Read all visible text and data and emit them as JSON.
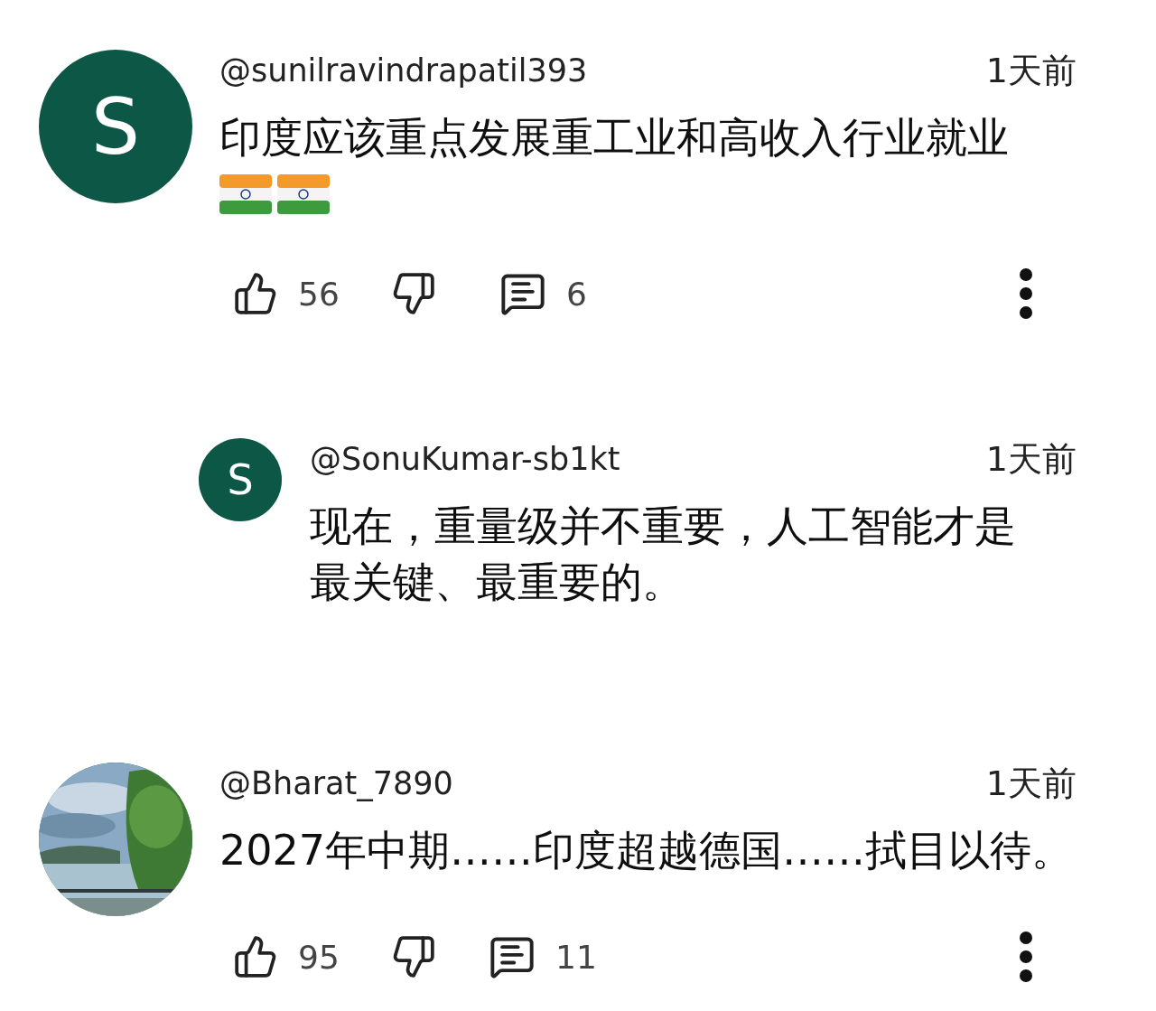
{
  "comments": [
    {
      "kind": "top",
      "avatar": {
        "kind": "letter",
        "letter": "S"
      },
      "username": "@sunilravindrapatil393",
      "time": "1天前",
      "text": "印度应该重点发展重工业和高收入行业就业",
      "flags": true,
      "likes": "56",
      "replies": "6"
    },
    {
      "kind": "reply",
      "avatar": {
        "kind": "letter",
        "letter": "S"
      },
      "username": "@SonuKumar-sb1kt",
      "time": "1天前",
      "text": "现在，重量级并不重要，人工智能才是最关键、最重要的。",
      "flags": false
    },
    {
      "kind": "top",
      "username": "@Bharat_7890",
      "time": "1天前",
      "text": "2027年中期……印度超越德国……拭目以待。",
      "flags": false,
      "likes": "95",
      "replies": "11"
    }
  ]
}
